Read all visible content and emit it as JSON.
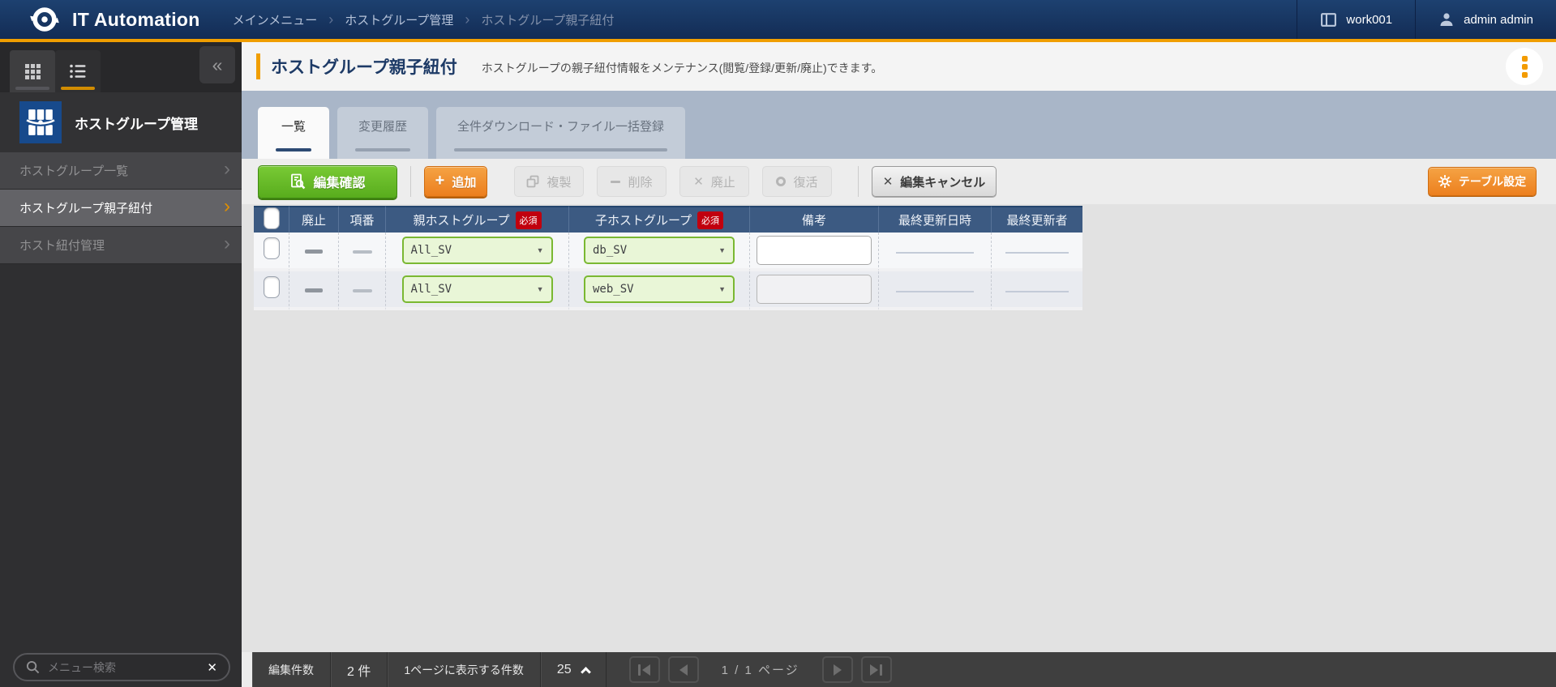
{
  "colors": {
    "accent_orange": "#f09e00",
    "header_navy": "#16335f",
    "confirm_green": "#62b626",
    "add_orange": "#ec7f1e",
    "required_red": "#c1000e",
    "select_green_bg": "#e9f6d7",
    "select_green_border": "#7ab832",
    "table_header_blue": "#3c5a82"
  },
  "icons": {
    "collapse": "«",
    "chevron_right": "›",
    "breadcrumb_separator": "›",
    "dropdown_arrow": "▼",
    "plus": "+",
    "close": "✕",
    "cross": "✕"
  },
  "header": {
    "app_title": "IT Automation",
    "breadcrumbs": [
      "メインメニュー",
      "ホストグループ管理",
      "ホストグループ親子紐付"
    ],
    "workspace": "work001",
    "user": "admin admin"
  },
  "sidebar": {
    "group_title": "ホストグループ管理",
    "items": [
      {
        "id": "hostgroup-list",
        "label": "ホストグループ一覧",
        "active": false
      },
      {
        "id": "hostgroup-parent-child",
        "label": "ホストグループ親子紐付",
        "active": true
      },
      {
        "id": "host-link-management",
        "label": "ホスト紐付管理",
        "active": false
      }
    ],
    "search_placeholder": "メニュー検索"
  },
  "page": {
    "title": "ホストグループ親子紐付",
    "description": "ホストグループの親子紐付情報をメンテナンス(閲覧/登録/更新/廃止)できます。"
  },
  "tabs": [
    {
      "id": "list",
      "label": "一覧",
      "active": true
    },
    {
      "id": "change-history",
      "label": "変更履歴",
      "active": false
    },
    {
      "id": "bulk-download",
      "label": "全件ダウンロード・ファイル一括登録",
      "active": false
    }
  ],
  "toolbar": {
    "edit_confirm": "編集確認",
    "add": "追加",
    "duplicate": "複製",
    "delete": "削除",
    "discard": "廃止",
    "restore": "復活",
    "cancel": "編集キャンセル",
    "table_settings": "テーブル設定"
  },
  "table": {
    "required_badge": "必須",
    "columns": [
      {
        "label": "廃止"
      },
      {
        "label": "項番"
      },
      {
        "label": "親ホストグループ",
        "required": true
      },
      {
        "label": "子ホストグループ",
        "required": true
      },
      {
        "label": "備考"
      },
      {
        "label": "最終更新日時"
      },
      {
        "label": "最終更新者"
      }
    ],
    "rows": [
      {
        "parent": "All_SV",
        "child": "db_SV",
        "note": ""
      },
      {
        "parent": "All_SV",
        "child": "web_SV",
        "note": ""
      }
    ]
  },
  "footer": {
    "edit_count_label": "編集件数",
    "edit_count_value": "2 件",
    "per_page_label": "1ページに表示する件数",
    "per_page_value": "25",
    "page_info": "1 / 1 ページ"
  }
}
